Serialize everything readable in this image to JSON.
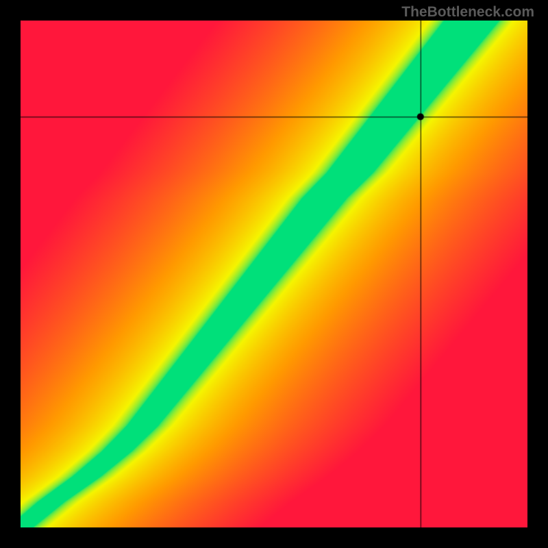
{
  "watermark": "TheBottleneck.com",
  "chart_data": {
    "type": "heatmap",
    "title": "",
    "xlabel": "",
    "ylabel": "",
    "xlim": [
      0,
      100
    ],
    "ylim": [
      0,
      100
    ],
    "description": "Bottleneck compatibility heatmap. Green diagonal ridge indicates optimal pairing; red regions indicate severe bottleneck. Ridge follows a slightly S-shaped curve from lower-left to upper-right, steeper than y=x in the mid/upper range.",
    "color_scale": {
      "optimal": "#00e07a",
      "near": "#f5f500",
      "mid": "#ff9a00",
      "worst": "#ff173b"
    },
    "marker": {
      "x": 79,
      "y": 81
    },
    "crosshair": {
      "x": 79,
      "y": 81
    },
    "ridge_samples": [
      {
        "y": 0,
        "x": 0
      },
      {
        "y": 5,
        "x": 6
      },
      {
        "y": 10,
        "x": 13
      },
      {
        "y": 15,
        "x": 19
      },
      {
        "y": 20,
        "x": 24
      },
      {
        "y": 25,
        "x": 28
      },
      {
        "y": 30,
        "x": 32
      },
      {
        "y": 35,
        "x": 36
      },
      {
        "y": 40,
        "x": 40
      },
      {
        "y": 45,
        "x": 44
      },
      {
        "y": 50,
        "x": 48
      },
      {
        "y": 55,
        "x": 52
      },
      {
        "y": 60,
        "x": 56
      },
      {
        "y": 65,
        "x": 60
      },
      {
        "y": 70,
        "x": 65
      },
      {
        "y": 75,
        "x": 69
      },
      {
        "y": 80,
        "x": 73
      },
      {
        "y": 85,
        "x": 77
      },
      {
        "y": 90,
        "x": 81
      },
      {
        "y": 95,
        "x": 85
      },
      {
        "y": 100,
        "x": 89
      }
    ],
    "band_half_width": 6
  }
}
